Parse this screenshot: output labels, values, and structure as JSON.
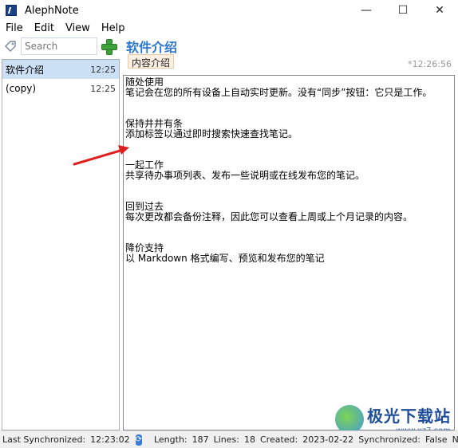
{
  "window": {
    "title": "AlephNote",
    "minimize": "—",
    "maximize": "☐",
    "close": "✕"
  },
  "menu": {
    "file": "File",
    "edit": "Edit",
    "view": "View",
    "help": "Help"
  },
  "sidebar": {
    "search_placeholder": "Search",
    "notes": [
      {
        "title": "软件介绍",
        "time": "12:25"
      },
      {
        "title": "(copy)",
        "time": "12:25"
      }
    ]
  },
  "note": {
    "title": "软件介绍",
    "tag": "内容介绍",
    "modified": "*12:26:56",
    "body": "随处使用\n笔记会在您的所有设备上自动实时更新。没有“同步”按钮：它只是工作。\n\n\n保持井井有条\n添加标签以通过即时搜索快速查找笔记。\n\n\n一起工作\n共享待办事项列表、发布一些说明或在线发布您的笔记。\n\n\n回到过去\n每次更改都会备份注释，因此您可以查看上周或上个月记录的内容。\n\n\n降价支持\n以 Markdown 格式编写、预览和发布您的笔记"
  },
  "status": {
    "last_sync_label": "Last Synchronized:",
    "last_sync_value": "12:23:02",
    "length_label": "Length:",
    "length_value": "187",
    "lines_label": "Lines:",
    "lines_value": "18",
    "created_label": "Created:",
    "created_value": "2023-02-22",
    "synchronized_label": "Synchronized:",
    "synchronized_value": "False",
    "trailing": "No Re"
  },
  "watermark": {
    "main": "极光下载站",
    "sub": "www.xz7.com"
  },
  "colors": {
    "accent": "#2e77d0",
    "selection": "#cce0f5",
    "arrow": "#e02020",
    "add_button": "#3da23a"
  }
}
